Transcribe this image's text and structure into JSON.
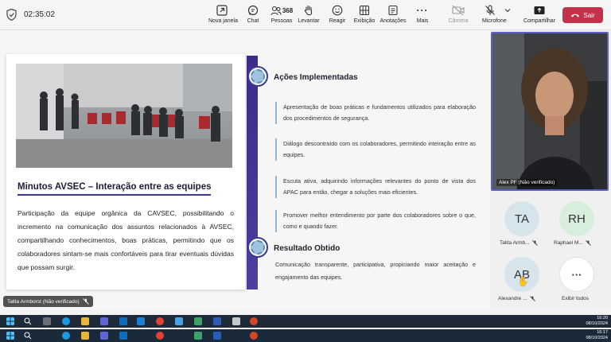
{
  "toolbar": {
    "timer": "02:35:02",
    "new_window": "Nova janela",
    "chat": "Chat",
    "people_count": "368",
    "people": "Pessoas",
    "raise": "Levantar",
    "react": "Reagir",
    "view": "Exibição",
    "notes": "Anotações",
    "more": "Mais",
    "camera": "Câmera",
    "mic": "Microfone",
    "share": "Compartilhar",
    "leave": "Sair"
  },
  "slide": {
    "title": "Minutos AVSEC – Interação entre as equipes",
    "paragraph": "Participação da equipe orgânica da CAVSEC, possibilitando o incremento na comunicação dos assuntos relacionados à AVSEC, compartilhando conhecimentos, boas práticas, permitindo que os colaboradores sintam-se mais confortáveis para tirar eventuais dúvidas que possam surgir.",
    "actions_heading": "Ações Implementadas",
    "actions": [
      "Apresentação de boas práticas e fundamentos utilizados para elaboração dos procedimentos de segurança.",
      "Diálogo descontraído com os colaboradores, permitindo inteiração entre as equipes.",
      "Escuta ativa, adquirindo informações relevantes do ponto de vista dos APAC para então, chegar a soluções mais eficientes.",
      "Promover melhor entendimento por parte dos colaboradores sobre o que, como e quando fazer."
    ],
    "result_heading": "Resultado Obtido",
    "result_text": "Comunicação transparente, participativa, propiciando maior aceitação e engajamento das equipes."
  },
  "presenter_label": "Talita Armborst (Não verificado)",
  "video_label": "Alex PF (Não verificado)",
  "participants": [
    {
      "initials": "TA",
      "name": "Talita Armb...",
      "color": "#d6e4ec"
    },
    {
      "initials": "RH",
      "name": "Raphael M...",
      "color": "#d8eedd"
    },
    {
      "initials": "AB",
      "name": "Alexandre ...",
      "color": "#d6e4ec"
    }
  ],
  "show_all": "Exibir todos",
  "taskbar": {
    "time1": "16:20",
    "date1": "08/10/2024",
    "time2": "16:17",
    "date2": "08/10/2024"
  }
}
